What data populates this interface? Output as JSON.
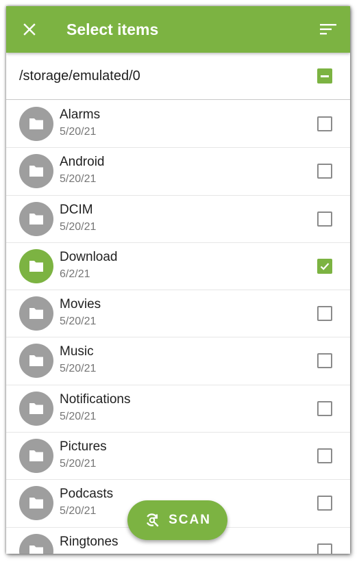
{
  "app_bar": {
    "title": "Select items",
    "close_icon": "close-icon",
    "sort_icon": "sort-icon",
    "background_color": "#7cb342"
  },
  "path_bar": {
    "path": "/storage/emulated/0",
    "select_all_state": "indeterminate"
  },
  "items": [
    {
      "name": "Alarms",
      "date": "5/20/21",
      "selected": false
    },
    {
      "name": "Android",
      "date": "5/20/21",
      "selected": false
    },
    {
      "name": "DCIM",
      "date": "5/20/21",
      "selected": false
    },
    {
      "name": "Download",
      "date": "6/2/21",
      "selected": true
    },
    {
      "name": "Movies",
      "date": "5/20/21",
      "selected": false
    },
    {
      "name": "Music",
      "date": "5/20/21",
      "selected": false
    },
    {
      "name": "Notifications",
      "date": "5/20/21",
      "selected": false
    },
    {
      "name": "Pictures",
      "date": "5/20/21",
      "selected": false
    },
    {
      "name": "Podcasts",
      "date": "5/20/21",
      "selected": false
    },
    {
      "name": "Ringtones",
      "date": "",
      "selected": false
    }
  ],
  "fab": {
    "label": "SCAN",
    "icon": "scan-refresh-icon"
  },
  "colors": {
    "accent": "#7cb342",
    "folder_default": "#9e9e9e",
    "checkbox_border": "#8a8a8a"
  }
}
